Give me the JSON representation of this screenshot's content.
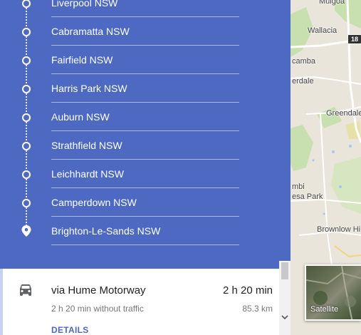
{
  "map": {
    "labels": {
      "mulgoa": "Mulgoa",
      "wallacia": "Wallacia",
      "camba": "camba",
      "erdale": "erdale",
      "greendale": "Greendale",
      "mbi": "mbi",
      "esa_park": "esa Park",
      "brownlow_hill": "Brownlow Hi"
    },
    "route_shield": "18",
    "colors": {
      "land": "#e9e5da",
      "park": "#c8dfb0",
      "water": "#a5c6f2",
      "road": "#ffffff"
    }
  },
  "directions": {
    "stops": [
      {
        "name": "Liverpool NSW",
        "marker": "circle-icon"
      },
      {
        "name": "Cabramatta NSW",
        "marker": "circle-icon"
      },
      {
        "name": "Fairfield NSW",
        "marker": "circle-icon"
      },
      {
        "name": "Harris Park NSW",
        "marker": "circle-icon"
      },
      {
        "name": "Auburn NSW",
        "marker": "circle-icon"
      },
      {
        "name": "Strathfield NSW",
        "marker": "circle-icon"
      },
      {
        "name": "Leichhardt NSW",
        "marker": "circle-icon"
      },
      {
        "name": "Camperdown NSW",
        "marker": "circle-icon"
      },
      {
        "name": "Brighton-Le-Sands NSW",
        "marker": "pin-icon"
      }
    ],
    "panel_color": "#4d69c2"
  },
  "route": {
    "mode_icon": "car-icon",
    "via": "via Hume Motorway",
    "duration": "2 h 20 min",
    "without_traffic": "2 h 20 min without traffic",
    "distance": "85.3 km",
    "details_label": "DETAILS"
  },
  "satellite": {
    "label": "Satellite"
  }
}
